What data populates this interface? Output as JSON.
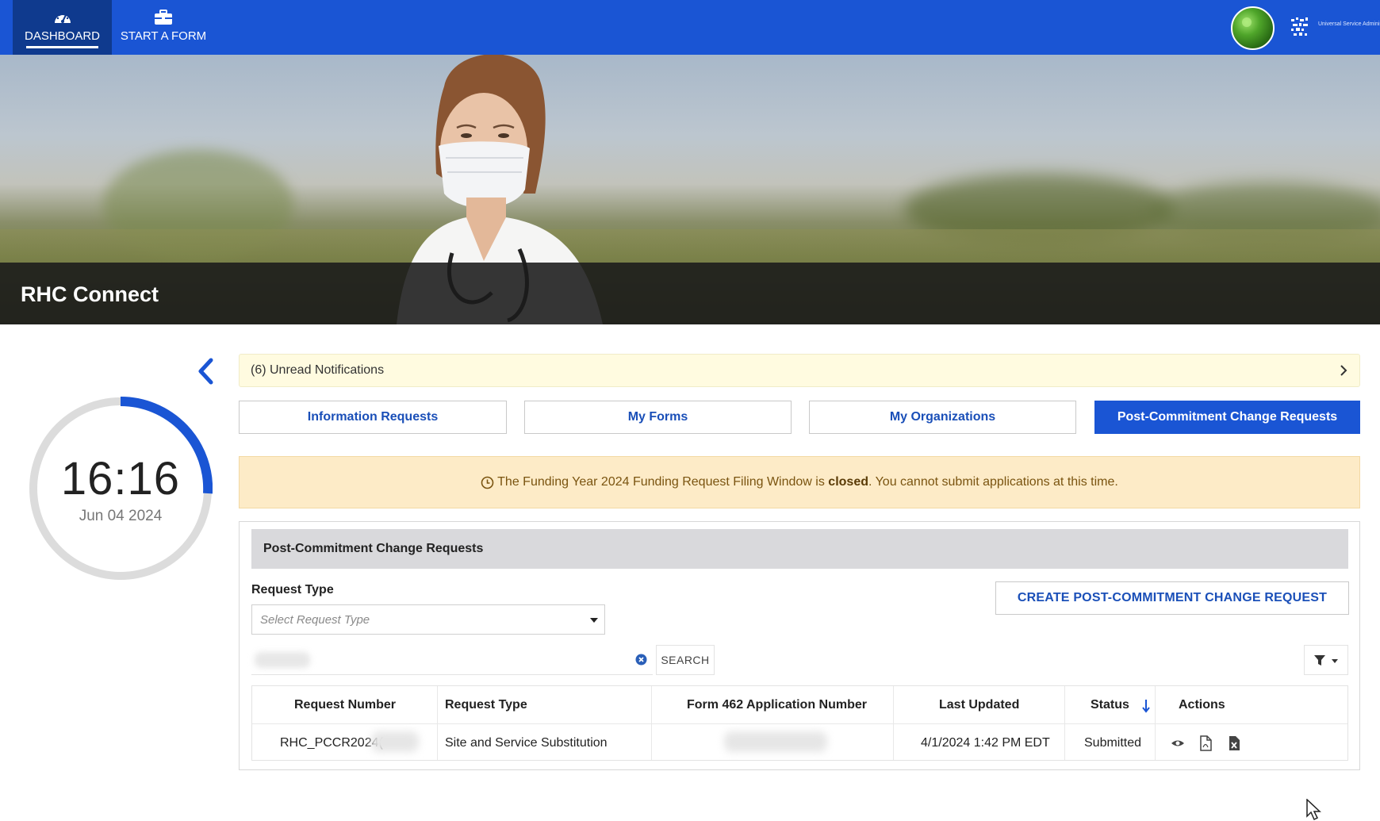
{
  "nav": {
    "items": [
      {
        "label": "DASHBOARD",
        "icon": "dashboard-gauge-icon",
        "active": true
      },
      {
        "label": "START A FORM",
        "icon": "briefcase-icon",
        "active": false
      }
    ],
    "logo_text": "Universal Service Administrative Co."
  },
  "hero": {
    "title": "RHC Connect"
  },
  "clock": {
    "time": "16:16",
    "date": "Jun 04 2024",
    "accent": "#1a55d4"
  },
  "notifications": {
    "label": "(6) Unread Notifications"
  },
  "tabs": [
    {
      "label": "Information Requests",
      "active": false
    },
    {
      "label": "My Forms",
      "active": false
    },
    {
      "label": "My Organizations",
      "active": false
    },
    {
      "label": "Post-Commitment Change Requests",
      "active": true
    }
  ],
  "banner": {
    "before": "The Funding Year 2024 Funding Request Filing Window is ",
    "bold": "closed",
    "after": ". You cannot submit applications at this time."
  },
  "panel": {
    "title": "Post-Commitment Change Requests",
    "request_type_label": "Request Type",
    "request_type_placeholder": "Select Request Type",
    "create_button": "CREATE POST-COMMITMENT CHANGE REQUEST",
    "search_button": "SEARCH"
  },
  "table": {
    "columns": [
      "Request Number",
      "Request Type",
      "Form 462 Application Number",
      "Last Updated",
      "Status",
      "Actions"
    ],
    "rows": [
      {
        "request_number": "RHC_PCCR2024(",
        "request_type": "Site and Service Substitution",
        "last_updated": "4/1/2024 1:42 PM EDT",
        "status": "Submitted",
        "actions": [
          "view-icon",
          "pdf-icon",
          "excel-icon"
        ]
      }
    ]
  },
  "colors": {
    "nav_bg": "#1a55d4",
    "nav_active_bg": "#0f3a8e",
    "link_blue": "#1a4fb8",
    "notif_bg": "#fffbe0",
    "banner_bg": "#fdebc7"
  }
}
